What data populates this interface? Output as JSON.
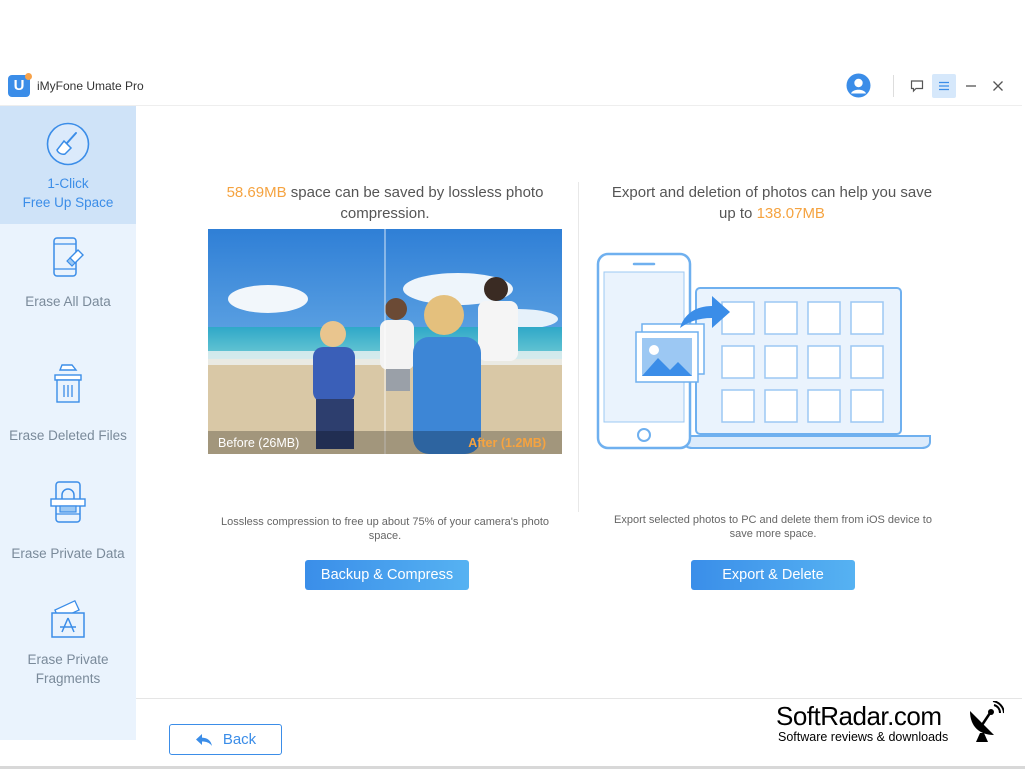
{
  "window": {
    "app_title": "iMyFone Umate Pro",
    "logo_letter": "U",
    "accent": "#3b8de8",
    "highlight": "#f5a340"
  },
  "titlebar": {
    "icons": [
      "user-avatar-icon",
      "feedback-icon",
      "menu-icon",
      "minimize-icon",
      "close-icon"
    ]
  },
  "sidebar": {
    "items": [
      {
        "label_line1": "1-Click",
        "label_line2": "Free Up Space",
        "icon": "broom-icon",
        "active": true
      },
      {
        "label": "Erase All Data",
        "icon": "phone-eraser-icon"
      },
      {
        "label": "Erase Deleted Files",
        "icon": "trash-icon"
      },
      {
        "label": "Erase Private Data",
        "icon": "lock-phone-icon"
      },
      {
        "label_line1": "Erase Private",
        "label_line2": "Fragments",
        "icon": "app-fragments-icon"
      }
    ]
  },
  "compress": {
    "amount": "58.69MB",
    "headline_rest": " space can be saved by lossless photo",
    "headline_line2": "compression.",
    "before_label": "Before (26MB)",
    "after_label": "After (1.2MB)",
    "caption_line1": "Lossless compression to free up about 75% of your camera's photo",
    "caption_line2": "space.",
    "button": "Backup & Compress"
  },
  "export": {
    "headline_line1": "Export and deletion of photos can help you save",
    "headline_prefix": "up to ",
    "amount": "138.07MB",
    "caption_line1": "Export selected photos to PC and delete them from iOS device to",
    "caption_line2": "save more space.",
    "button": "Export & Delete"
  },
  "footer": {
    "back_label": "Back"
  },
  "watermark": {
    "name": "SoftRadar.com",
    "tagline": "Software reviews & downloads"
  }
}
